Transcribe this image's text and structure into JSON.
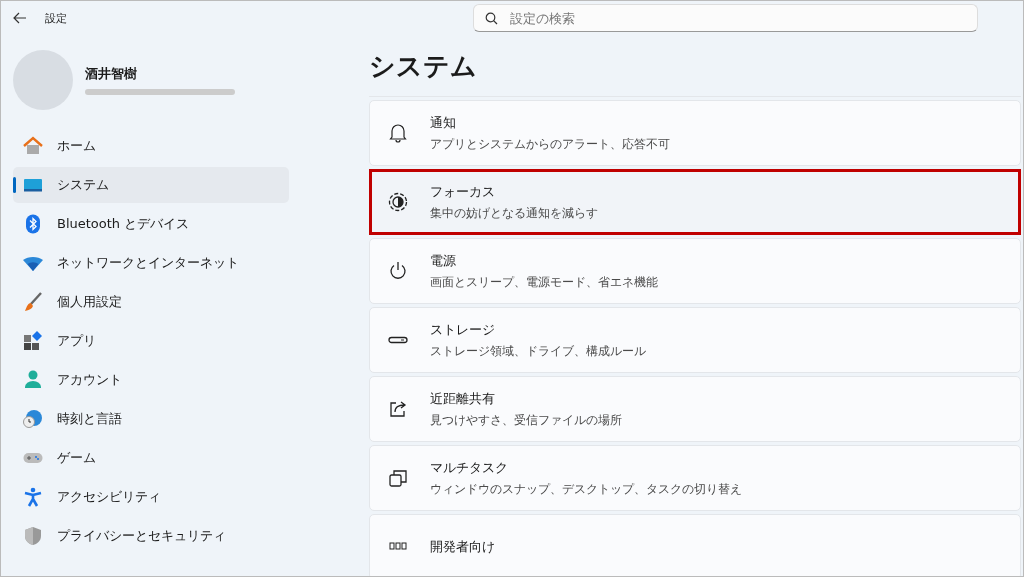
{
  "window": {
    "title": "設定"
  },
  "search": {
    "placeholder": "設定の検索"
  },
  "account": {
    "name": "酒井智樹"
  },
  "sidebar": {
    "items": [
      {
        "label": "ホーム",
        "selected": false
      },
      {
        "label": "システム",
        "selected": true
      },
      {
        "label": "Bluetooth とデバイス",
        "selected": false
      },
      {
        "label": "ネットワークとインターネット",
        "selected": false
      },
      {
        "label": "個人用設定",
        "selected": false
      },
      {
        "label": "アプリ",
        "selected": false
      },
      {
        "label": "アカウント",
        "selected": false
      },
      {
        "label": "時刻と言語",
        "selected": false
      },
      {
        "label": "ゲーム",
        "selected": false
      },
      {
        "label": "アクセシビリティ",
        "selected": false
      },
      {
        "label": "プライバシーとセキュリティ",
        "selected": false
      }
    ]
  },
  "page": {
    "title": "システム",
    "cards": [
      {
        "title": "通知",
        "subtitle": "アプリとシステムからのアラート、応答不可",
        "highlighted": false
      },
      {
        "title": "フォーカス",
        "subtitle": "集中の妨げとなる通知を減らす",
        "highlighted": true
      },
      {
        "title": "電源",
        "subtitle": "画面とスリープ、電源モード、省エネ機能",
        "highlighted": false
      },
      {
        "title": "ストレージ",
        "subtitle": "ストレージ領域、ドライブ、構成ルール",
        "highlighted": false
      },
      {
        "title": "近距離共有",
        "subtitle": "見つけやすさ、受信ファイルの場所",
        "highlighted": false
      },
      {
        "title": "マルチタスク",
        "subtitle": "ウィンドウのスナップ、デスクトップ、タスクの切り替え",
        "highlighted": false
      },
      {
        "title": "開発者向け",
        "highlighted": false
      }
    ]
  }
}
